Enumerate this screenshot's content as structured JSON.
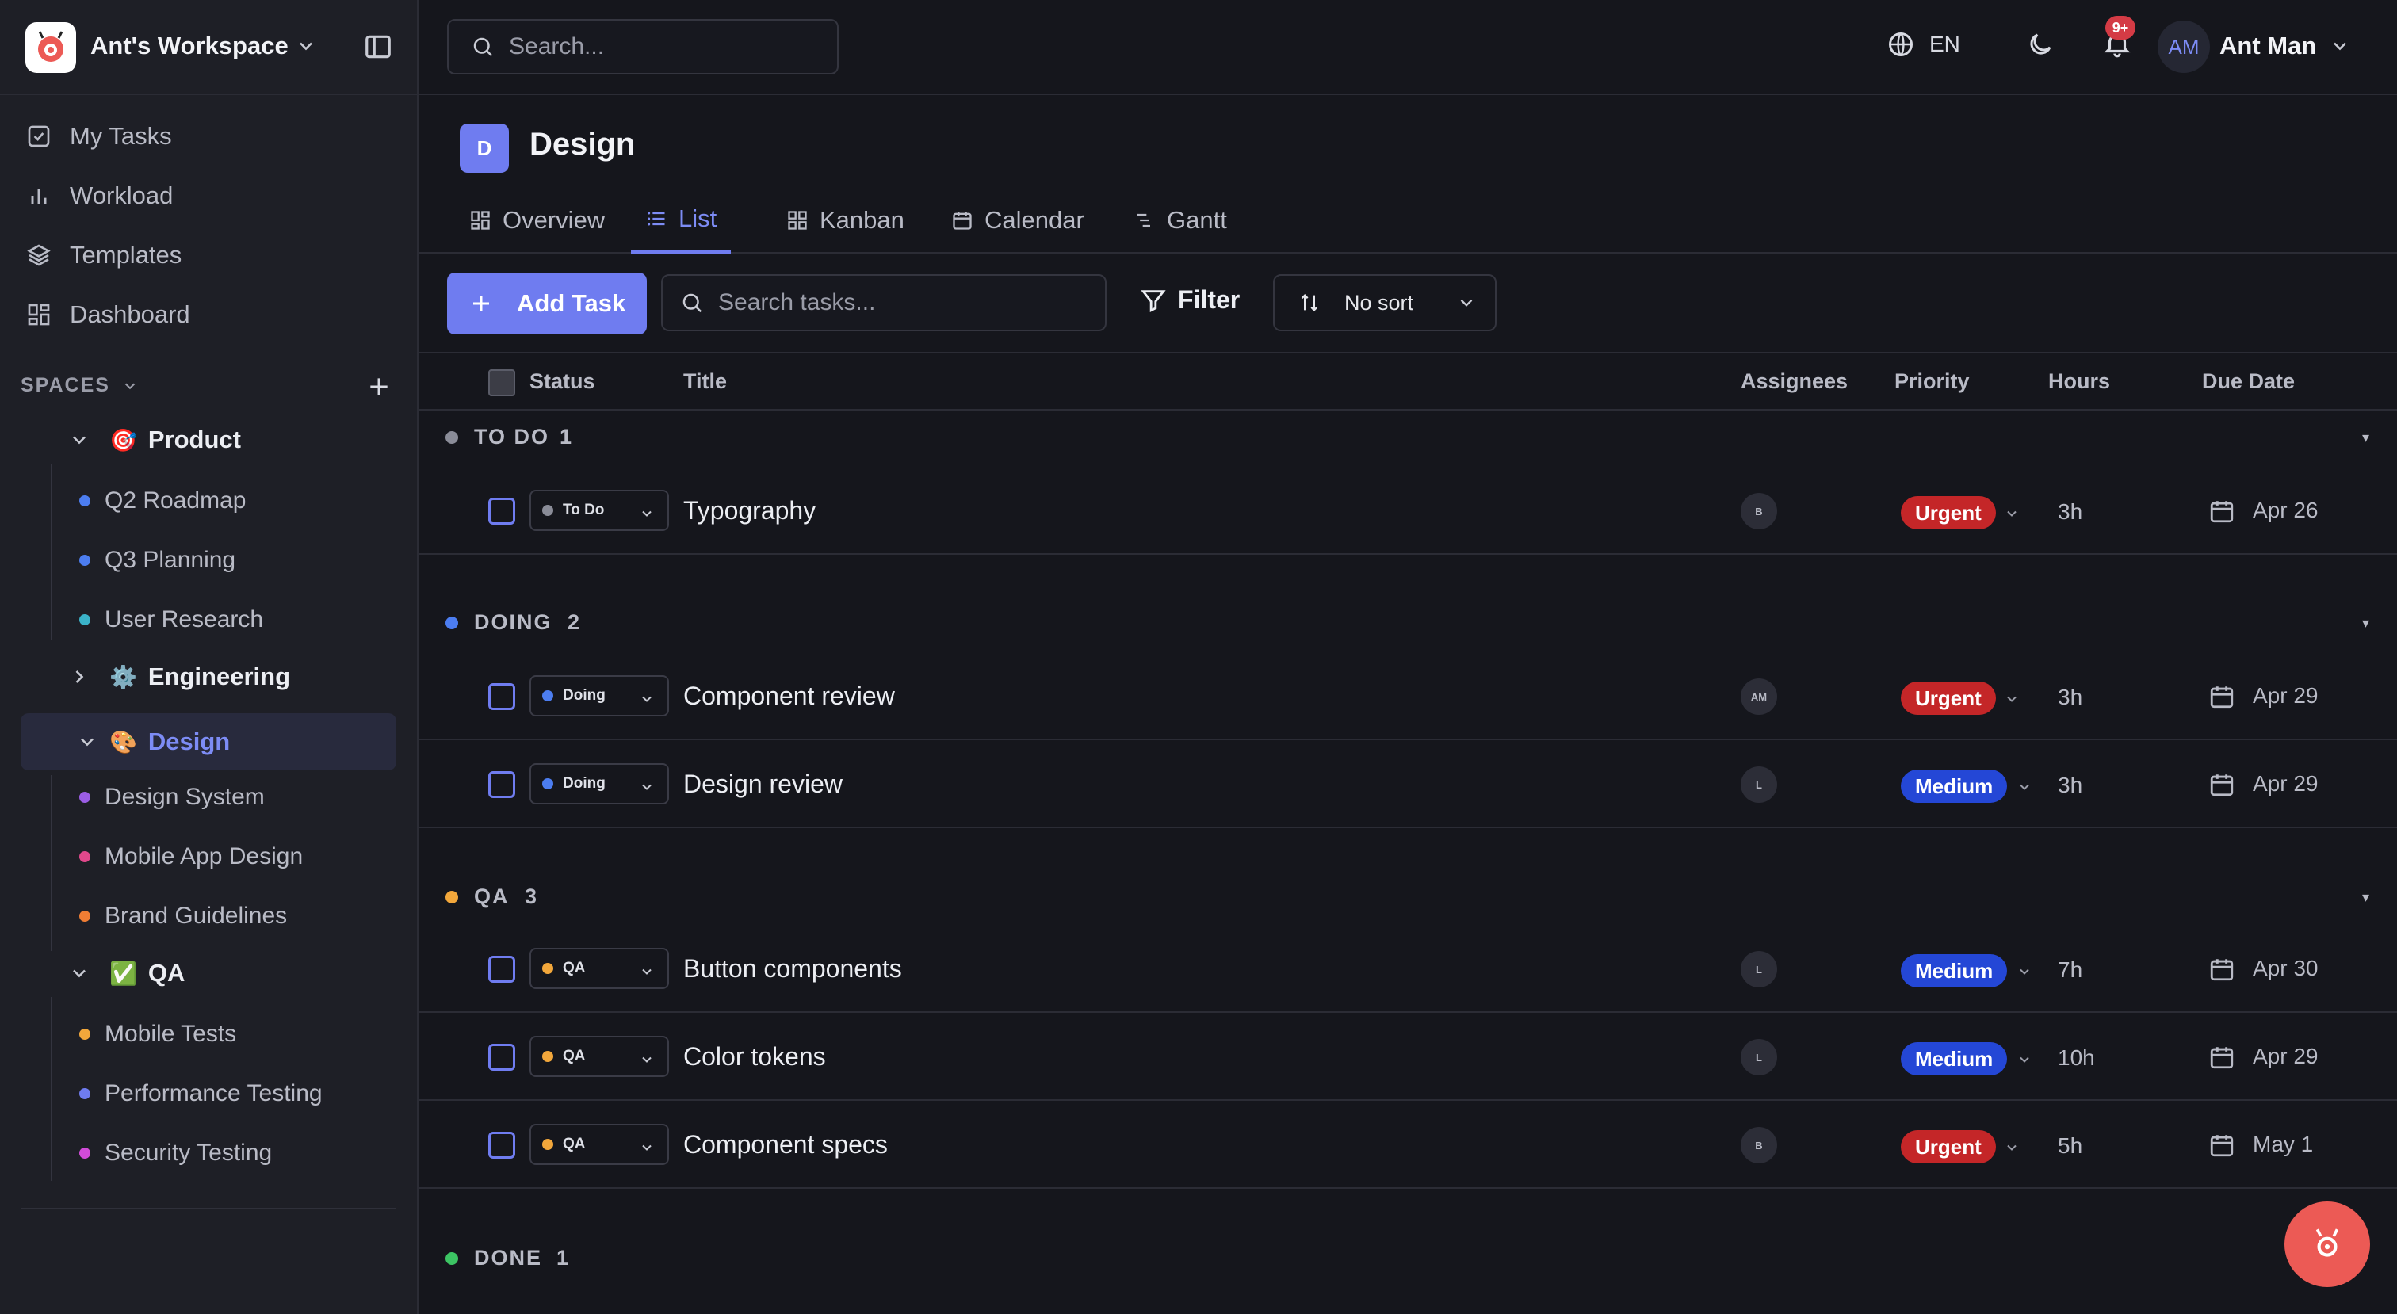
{
  "workspace": {
    "name": "Ant's Workspace"
  },
  "nav": [
    {
      "label": "My Tasks",
      "icon": "check-square-icon"
    },
    {
      "label": "Workload",
      "icon": "bar-chart-icon"
    },
    {
      "label": "Templates",
      "icon": "layers-icon"
    },
    {
      "label": "Dashboard",
      "icon": "grid-icon"
    }
  ],
  "spaces": {
    "label": "SPACES",
    "product": {
      "name": "Product",
      "emoji": "🎯",
      "lists": [
        "Q2 Roadmap",
        "Q3 Planning",
        "User Research"
      ],
      "colors": [
        "#4c7df0",
        "#4c7df0",
        "#3bb3c9"
      ]
    },
    "engineering": {
      "name": "Engineering",
      "emoji": "⚙️"
    },
    "design": {
      "name": "Design",
      "emoji": "🎨",
      "lists": [
        "Design System",
        "Mobile App Design",
        "Brand Guidelines"
      ],
      "colors": [
        "#9b5de5",
        "#e0488b",
        "#ef7d34"
      ]
    },
    "qa": {
      "name": "QA",
      "emoji": "✅",
      "lists": [
        "Mobile Tests",
        "Performance Testing",
        "Security Testing"
      ],
      "colors": [
        "#f2a73b",
        "#6f7cf0",
        "#d14bd8"
      ]
    }
  },
  "topbar": {
    "search_placeholder": "Search...",
    "language": "EN",
    "notifications_badge": "9+",
    "user_initials": "AM",
    "user_name": "Ant Man"
  },
  "page": {
    "icon_letter": "D",
    "title": "Design"
  },
  "tabs": [
    "Overview",
    "List",
    "Kanban",
    "Calendar",
    "Gantt"
  ],
  "toolbar": {
    "add_task": "Add Task",
    "search_placeholder": "Search tasks...",
    "filter": "Filter",
    "sort": "No sort"
  },
  "columns": {
    "status": "Status",
    "title": "Title",
    "assignees": "Assignees",
    "priority": "Priority",
    "hours": "Hours",
    "due_date": "Due Date"
  },
  "groups": [
    {
      "name": "TO DO",
      "count": "1",
      "color": "#8a8c98",
      "tasks": [
        {
          "status": "To Do",
          "title": "Typography",
          "assignee": "B",
          "priority": "Urgent",
          "hours": "3h",
          "due": "Apr 26"
        }
      ]
    },
    {
      "name": "DOING",
      "count": "2",
      "color": "#4c7df0",
      "tasks": [
        {
          "status": "Doing",
          "title": "Component review",
          "assignee": "AM",
          "priority": "Urgent",
          "hours": "3h",
          "due": "Apr 29"
        },
        {
          "status": "Doing",
          "title": "Design review",
          "assignee": "L",
          "priority": "Medium",
          "hours": "3h",
          "due": "Apr 29"
        }
      ]
    },
    {
      "name": "QA",
      "count": "3",
      "color": "#f2a73b",
      "tasks": [
        {
          "status": "QA",
          "title": "Button components",
          "assignee": "L",
          "priority": "Medium",
          "hours": "7h",
          "due": "Apr 30"
        },
        {
          "status": "QA",
          "title": "Color tokens",
          "assignee": "L",
          "priority": "Medium",
          "hours": "10h",
          "due": "Apr 29"
        },
        {
          "status": "QA",
          "title": "Component specs",
          "assignee": "B",
          "priority": "Urgent",
          "hours": "5h",
          "due": "May 1"
        }
      ]
    },
    {
      "name": "DONE",
      "count": "1",
      "color": "#3cc463",
      "tasks": []
    }
  ],
  "colors": {
    "accent": "#6f7cf0",
    "urgent": "#c42628",
    "medium": "#2447d6"
  }
}
